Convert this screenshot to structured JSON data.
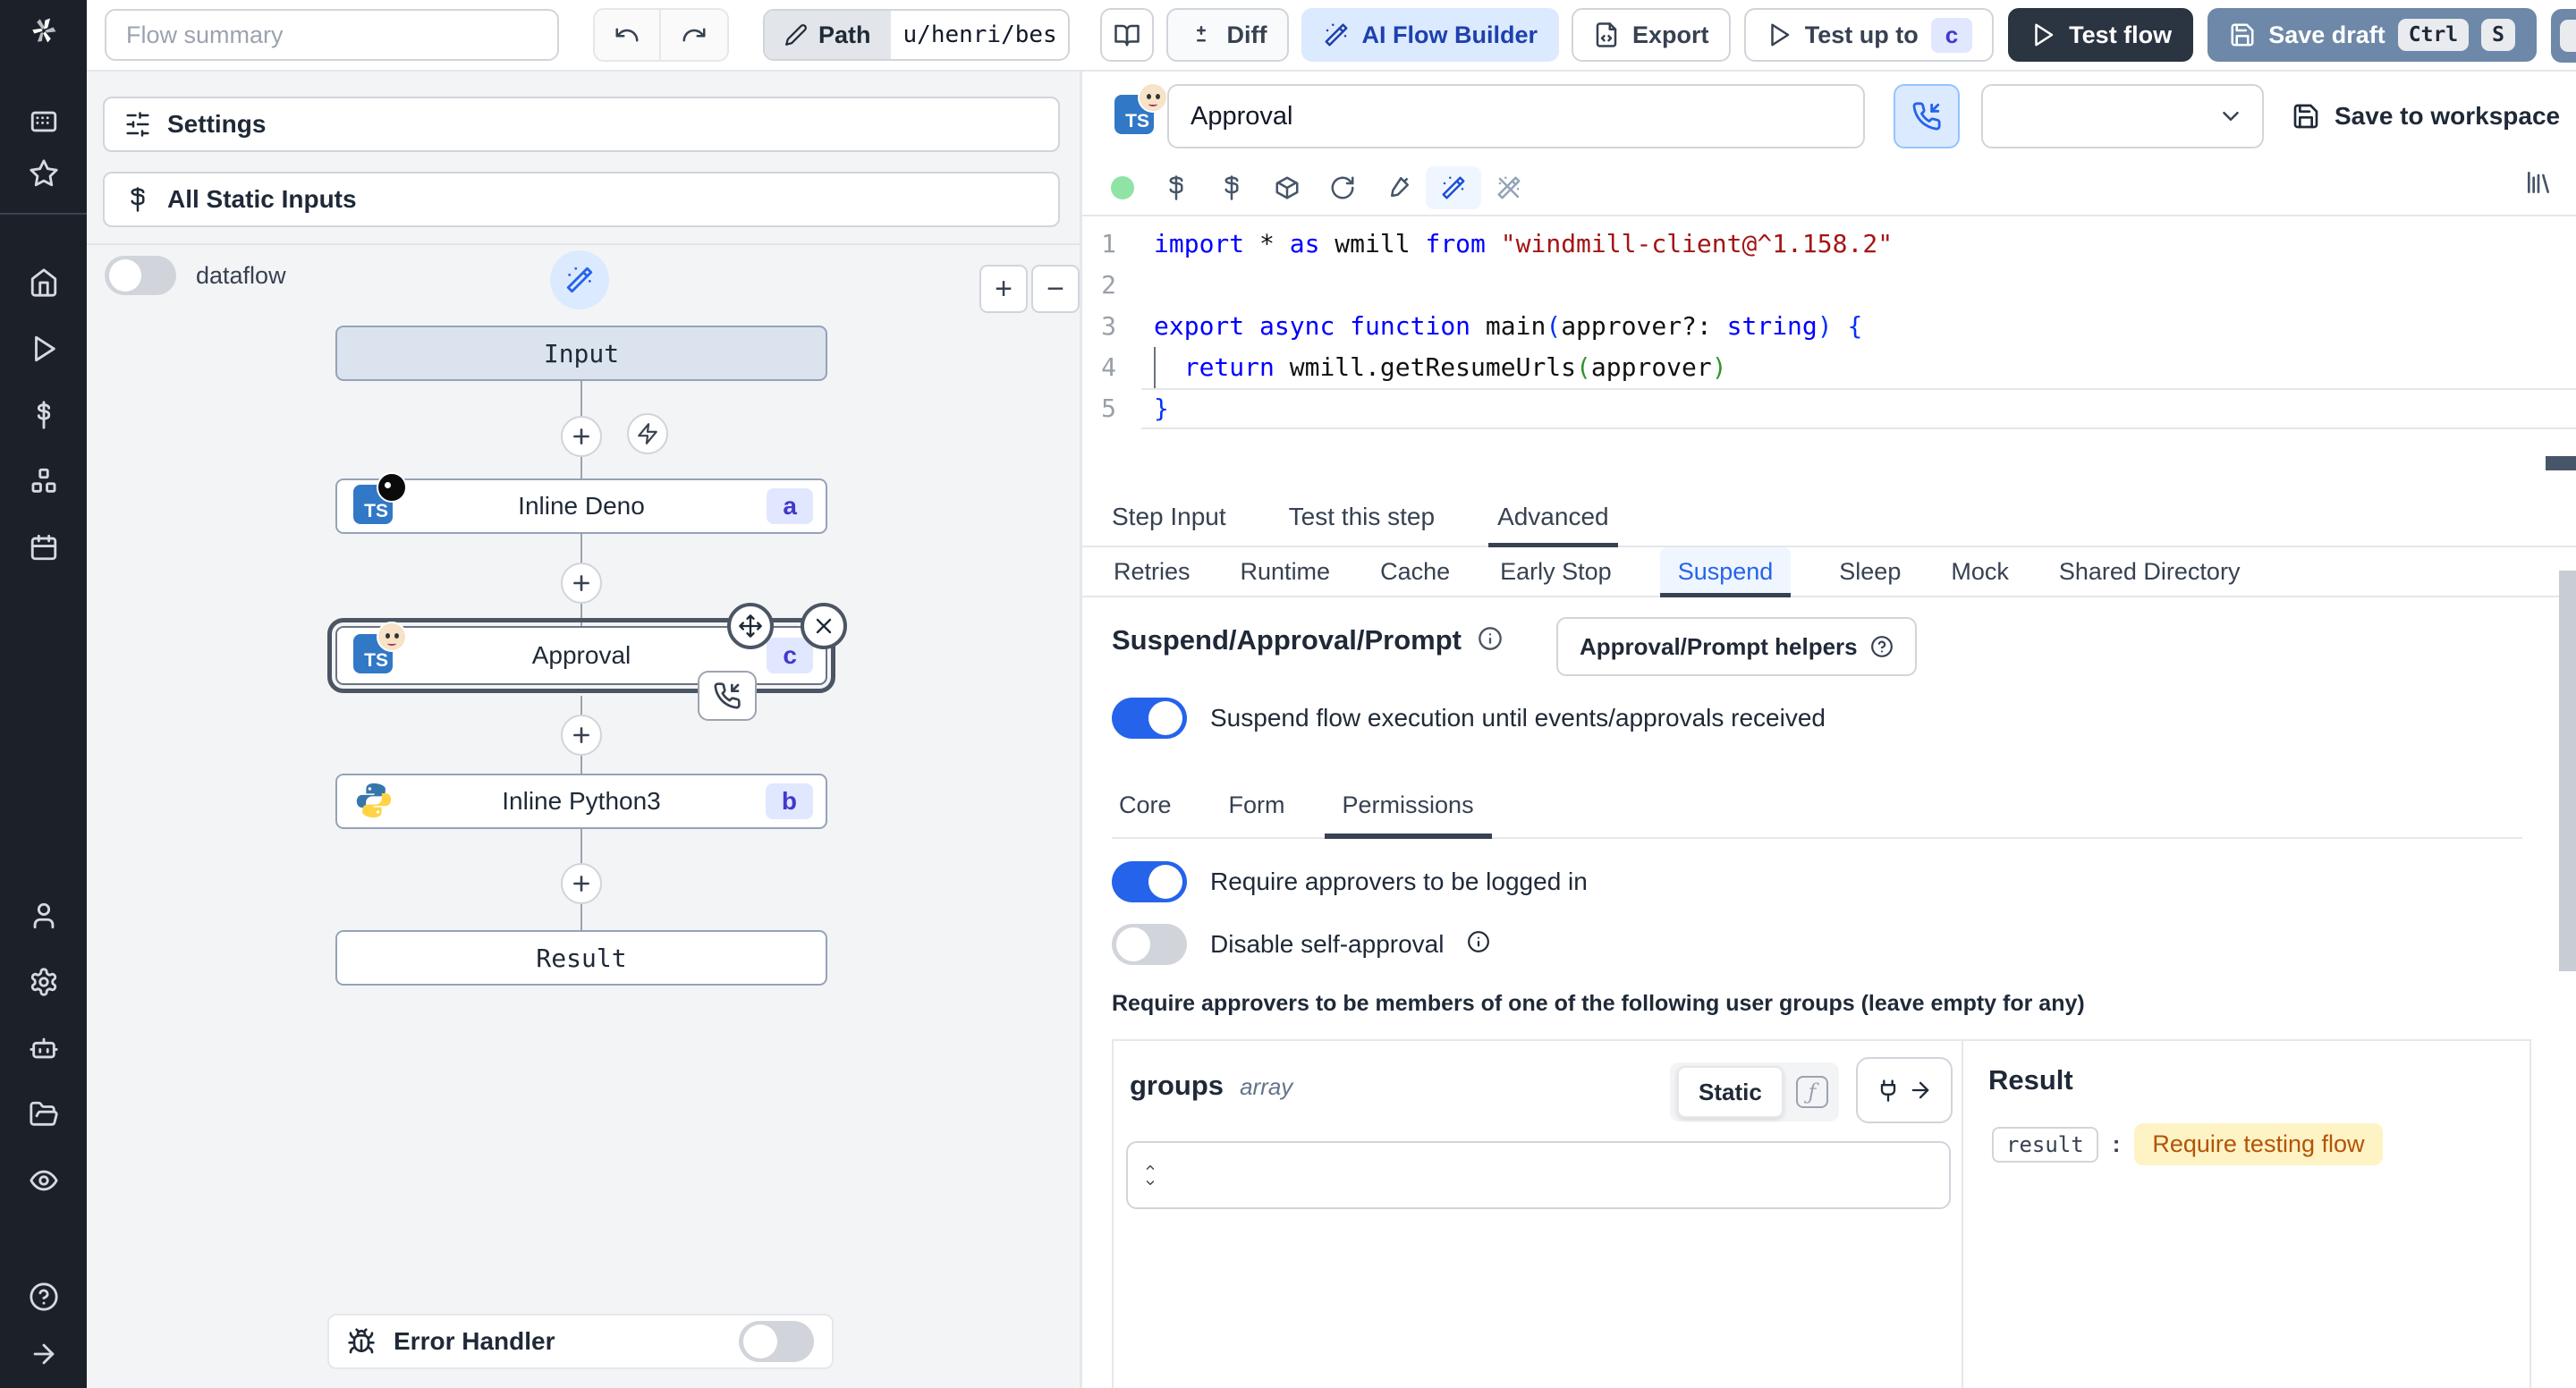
{
  "topbar": {
    "flow_summary_placeholder": "Flow summary",
    "path_label": "Path",
    "path_value": "u/henri/bes",
    "diff_label": "Diff",
    "ai_flow_builder_label": "AI Flow Builder",
    "export_label": "Export",
    "test_up_to_label": "Test up to",
    "test_up_to_badge": "c",
    "test_flow_label": "Test flow",
    "save_draft_label": "Save draft",
    "save_draft_keys": [
      "Ctrl",
      "S"
    ]
  },
  "sidebar": {
    "icons": [
      "windmill-logo",
      "apps",
      "favorites",
      "home",
      "runs",
      "variables",
      "resources",
      "schedules",
      "users",
      "settings",
      "workers",
      "folders",
      "audit-logs",
      "help",
      "expand"
    ]
  },
  "flow_panel": {
    "settings_label": "Settings",
    "static_inputs_label": "All Static Inputs",
    "dataflow_label": "dataflow",
    "zoom_in": "+",
    "zoom_out": "−",
    "nodes": {
      "input": "Input",
      "deno": {
        "label": "Inline Deno",
        "badge": "a"
      },
      "approval": {
        "label": "Approval",
        "badge": "c"
      },
      "python": {
        "label": "Inline Python3",
        "badge": "b"
      },
      "result": "Result"
    },
    "error_handler_label": "Error Handler"
  },
  "step": {
    "name": "Approval",
    "save_to_workspace": "Save to workspace",
    "code": {
      "lines": [
        {
          "n": "1",
          "tokens": [
            [
              "kw",
              "import"
            ],
            [
              "pl",
              " * "
            ],
            [
              "kw",
              "as"
            ],
            [
              "pl",
              " wmill "
            ],
            [
              "kw",
              "from"
            ],
            [
              "pl",
              " "
            ],
            [
              "str",
              "\"windmill-client@^1.158.2\""
            ]
          ]
        },
        {
          "n": "2",
          "tokens": []
        },
        {
          "n": "3",
          "tokens": [
            [
              "kw",
              "export"
            ],
            [
              "pl",
              " "
            ],
            [
              "kw",
              "async"
            ],
            [
              "pl",
              " "
            ],
            [
              "kw",
              "function"
            ],
            [
              "pl",
              " main"
            ],
            [
              "b1",
              "("
            ],
            [
              "pl",
              "approver?: "
            ],
            [
              "kw",
              "string"
            ],
            [
              "b1",
              ")"
            ],
            [
              "pl",
              " "
            ],
            [
              "b1",
              "{"
            ]
          ]
        },
        {
          "n": "4",
          "guide": true,
          "tokens": [
            [
              "pl",
              "  "
            ],
            [
              "kw",
              "return"
            ],
            [
              "pl",
              " wmill.getResumeUrls"
            ],
            [
              "b2",
              "("
            ],
            [
              "pl",
              "approver"
            ],
            [
              "b2",
              ")"
            ]
          ]
        },
        {
          "n": "5",
          "current": true,
          "tokens": [
            [
              "b1",
              "}"
            ]
          ]
        }
      ]
    },
    "tabs": [
      {
        "label": "Step Input"
      },
      {
        "label": "Test this step"
      },
      {
        "label": "Advanced"
      }
    ],
    "subtabs": [
      {
        "label": "Retries"
      },
      {
        "label": "Runtime"
      },
      {
        "label": "Cache"
      },
      {
        "label": "Early Stop"
      },
      {
        "label": "Suspend"
      },
      {
        "label": "Sleep"
      },
      {
        "label": "Mock"
      },
      {
        "label": "Shared Directory"
      }
    ],
    "suspend": {
      "heading": "Suspend/Approval/Prompt",
      "helpers_button": "Approval/Prompt helpers",
      "enable_label": "Suspend flow execution until events/approvals received",
      "inner_tabs": [
        {
          "label": "Core"
        },
        {
          "label": "Form"
        },
        {
          "label": "Permissions"
        }
      ],
      "require_login_label": "Require approvers to be logged in",
      "disable_self_approval_label": "Disable self-approval",
      "groups_hint": "Require approvers to be members of one of the following user groups (leave empty for any)",
      "groups_field_name": "groups",
      "groups_field_type": "array",
      "static_label": "Static"
    },
    "result": {
      "title": "Result",
      "key": "result",
      "value": "Require testing flow"
    }
  },
  "colors": {
    "accent_blue": "#2563eb",
    "toolbar_save": "#6d88a8",
    "dark_button": "#2b3441",
    "badge_bg": "#e0e7ff",
    "badge_text": "#4338ca",
    "result_value_bg": "#fdf3c4",
    "result_value_text": "#b45309"
  }
}
